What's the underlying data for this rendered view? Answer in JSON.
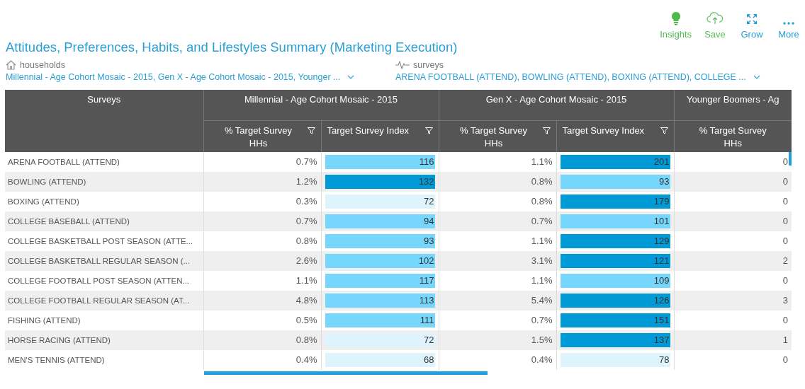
{
  "toolbar": [
    {
      "kind": "insights",
      "label": "Insights"
    },
    {
      "kind": "save",
      "label": "Save"
    },
    {
      "kind": "grow",
      "label": "Grow"
    },
    {
      "kind": "more",
      "label": "More"
    }
  ],
  "title": "Attitudes, Preferences, Habits, and Lifestyles Summary (Marketing Execution)",
  "filters": [
    {
      "kind": "households",
      "label": "households",
      "value": "Millennial - Age Cohort Mosaic - 2015, Gen X - Age Cohort Mosaic - 2015, Younger ..."
    },
    {
      "kind": "surveys",
      "label": "surveys",
      "value": "ARENA FOOTBALL (ATTEND), BOWLING (ATTEND), BOXING (ATTEND), COLLEGE ..."
    }
  ],
  "table": {
    "first_column": "Surveys",
    "groups": [
      {
        "label": "Millennial - Age Cohort Mosaic - 2015",
        "columns": [
          {
            "label": "% Target Survey HHs",
            "filter": true
          },
          {
            "label": "Target Survey Index",
            "filter": true
          }
        ]
      },
      {
        "label": "Gen X - Age Cohort Mosaic - 2015",
        "columns": [
          {
            "label": "% Target Survey HHs",
            "filter": true
          },
          {
            "label": "Target Survey Index",
            "filter": true
          }
        ]
      },
      {
        "label": "Younger Boomers - Ag",
        "columns": [
          {
            "label": "% Target Survey HHs",
            "filter": false
          }
        ]
      }
    ],
    "rows": [
      {
        "label": "ARENA FOOTBALL (ATTEND)",
        "cells": [
          {
            "pct": "0.7%",
            "index": "116",
            "color": "#76d6fb"
          },
          {
            "pct": "1.1%",
            "index": "201",
            "color": "#009ad6"
          },
          {
            "pct": "0"
          }
        ]
      },
      {
        "label": "BOWLING (ATTEND)",
        "cells": [
          {
            "pct": "1.2%",
            "index": "132",
            "color": "#009ad6"
          },
          {
            "pct": "0.8%",
            "index": "93",
            "color": "#76d6fb"
          },
          {
            "pct": "0"
          }
        ]
      },
      {
        "label": "BOXING (ATTEND)",
        "cells": [
          {
            "pct": "0.3%",
            "index": "72",
            "color": "#dff3fc"
          },
          {
            "pct": "0.8%",
            "index": "179",
            "color": "#009ad6"
          },
          {
            "pct": "0"
          }
        ]
      },
      {
        "label": "COLLEGE BASEBALL (ATTEND)",
        "cells": [
          {
            "pct": "0.7%",
            "index": "94",
            "color": "#76d6fb"
          },
          {
            "pct": "0.7%",
            "index": "101",
            "color": "#76d6fb"
          },
          {
            "pct": "0"
          }
        ]
      },
      {
        "label": "COLLEGE BASKETBALL POST SEASON (ATTE...",
        "cells": [
          {
            "pct": "0.8%",
            "index": "93",
            "color": "#76d6fb"
          },
          {
            "pct": "1.1%",
            "index": "129",
            "color": "#009ad6"
          },
          {
            "pct": "0"
          }
        ]
      },
      {
        "label": "COLLEGE BASKETBALL REGULAR SEASON (...",
        "cells": [
          {
            "pct": "2.6%",
            "index": "102",
            "color": "#76d6fb"
          },
          {
            "pct": "3.1%",
            "index": "121",
            "color": "#009ad6"
          },
          {
            "pct": "2"
          }
        ]
      },
      {
        "label": "COLLEGE FOOTBALL POST SEASON (ATTEN...",
        "cells": [
          {
            "pct": "1.1%",
            "index": "117",
            "color": "#76d6fb"
          },
          {
            "pct": "1.1%",
            "index": "109",
            "color": "#76d6fb"
          },
          {
            "pct": "0"
          }
        ]
      },
      {
        "label": "COLLEGE FOOTBALL REGULAR SEASON (AT...",
        "cells": [
          {
            "pct": "4.8%",
            "index": "113",
            "color": "#76d6fb"
          },
          {
            "pct": "5.4%",
            "index": "126",
            "color": "#009ad6"
          },
          {
            "pct": "3"
          }
        ]
      },
      {
        "label": "FISHING (ATTEND)",
        "cells": [
          {
            "pct": "0.5%",
            "index": "111",
            "color": "#76d6fb"
          },
          {
            "pct": "0.7%",
            "index": "151",
            "color": "#009ad6"
          },
          {
            "pct": "0"
          }
        ]
      },
      {
        "label": "HORSE RACING (ATTEND)",
        "cells": [
          {
            "pct": "0.8%",
            "index": "72",
            "color": "#dff3fc"
          },
          {
            "pct": "1.5%",
            "index": "137",
            "color": "#009ad6"
          },
          {
            "pct": "1"
          }
        ]
      },
      {
        "label": "MEN'S TENNIS (ATTEND)",
        "cells": [
          {
            "pct": "0.4%",
            "index": "68",
            "color": "#dff3fc"
          },
          {
            "pct": "0.4%",
            "index": "78",
            "color": "#dff3fc"
          },
          {
            "pct": "0"
          }
        ]
      }
    ]
  }
}
